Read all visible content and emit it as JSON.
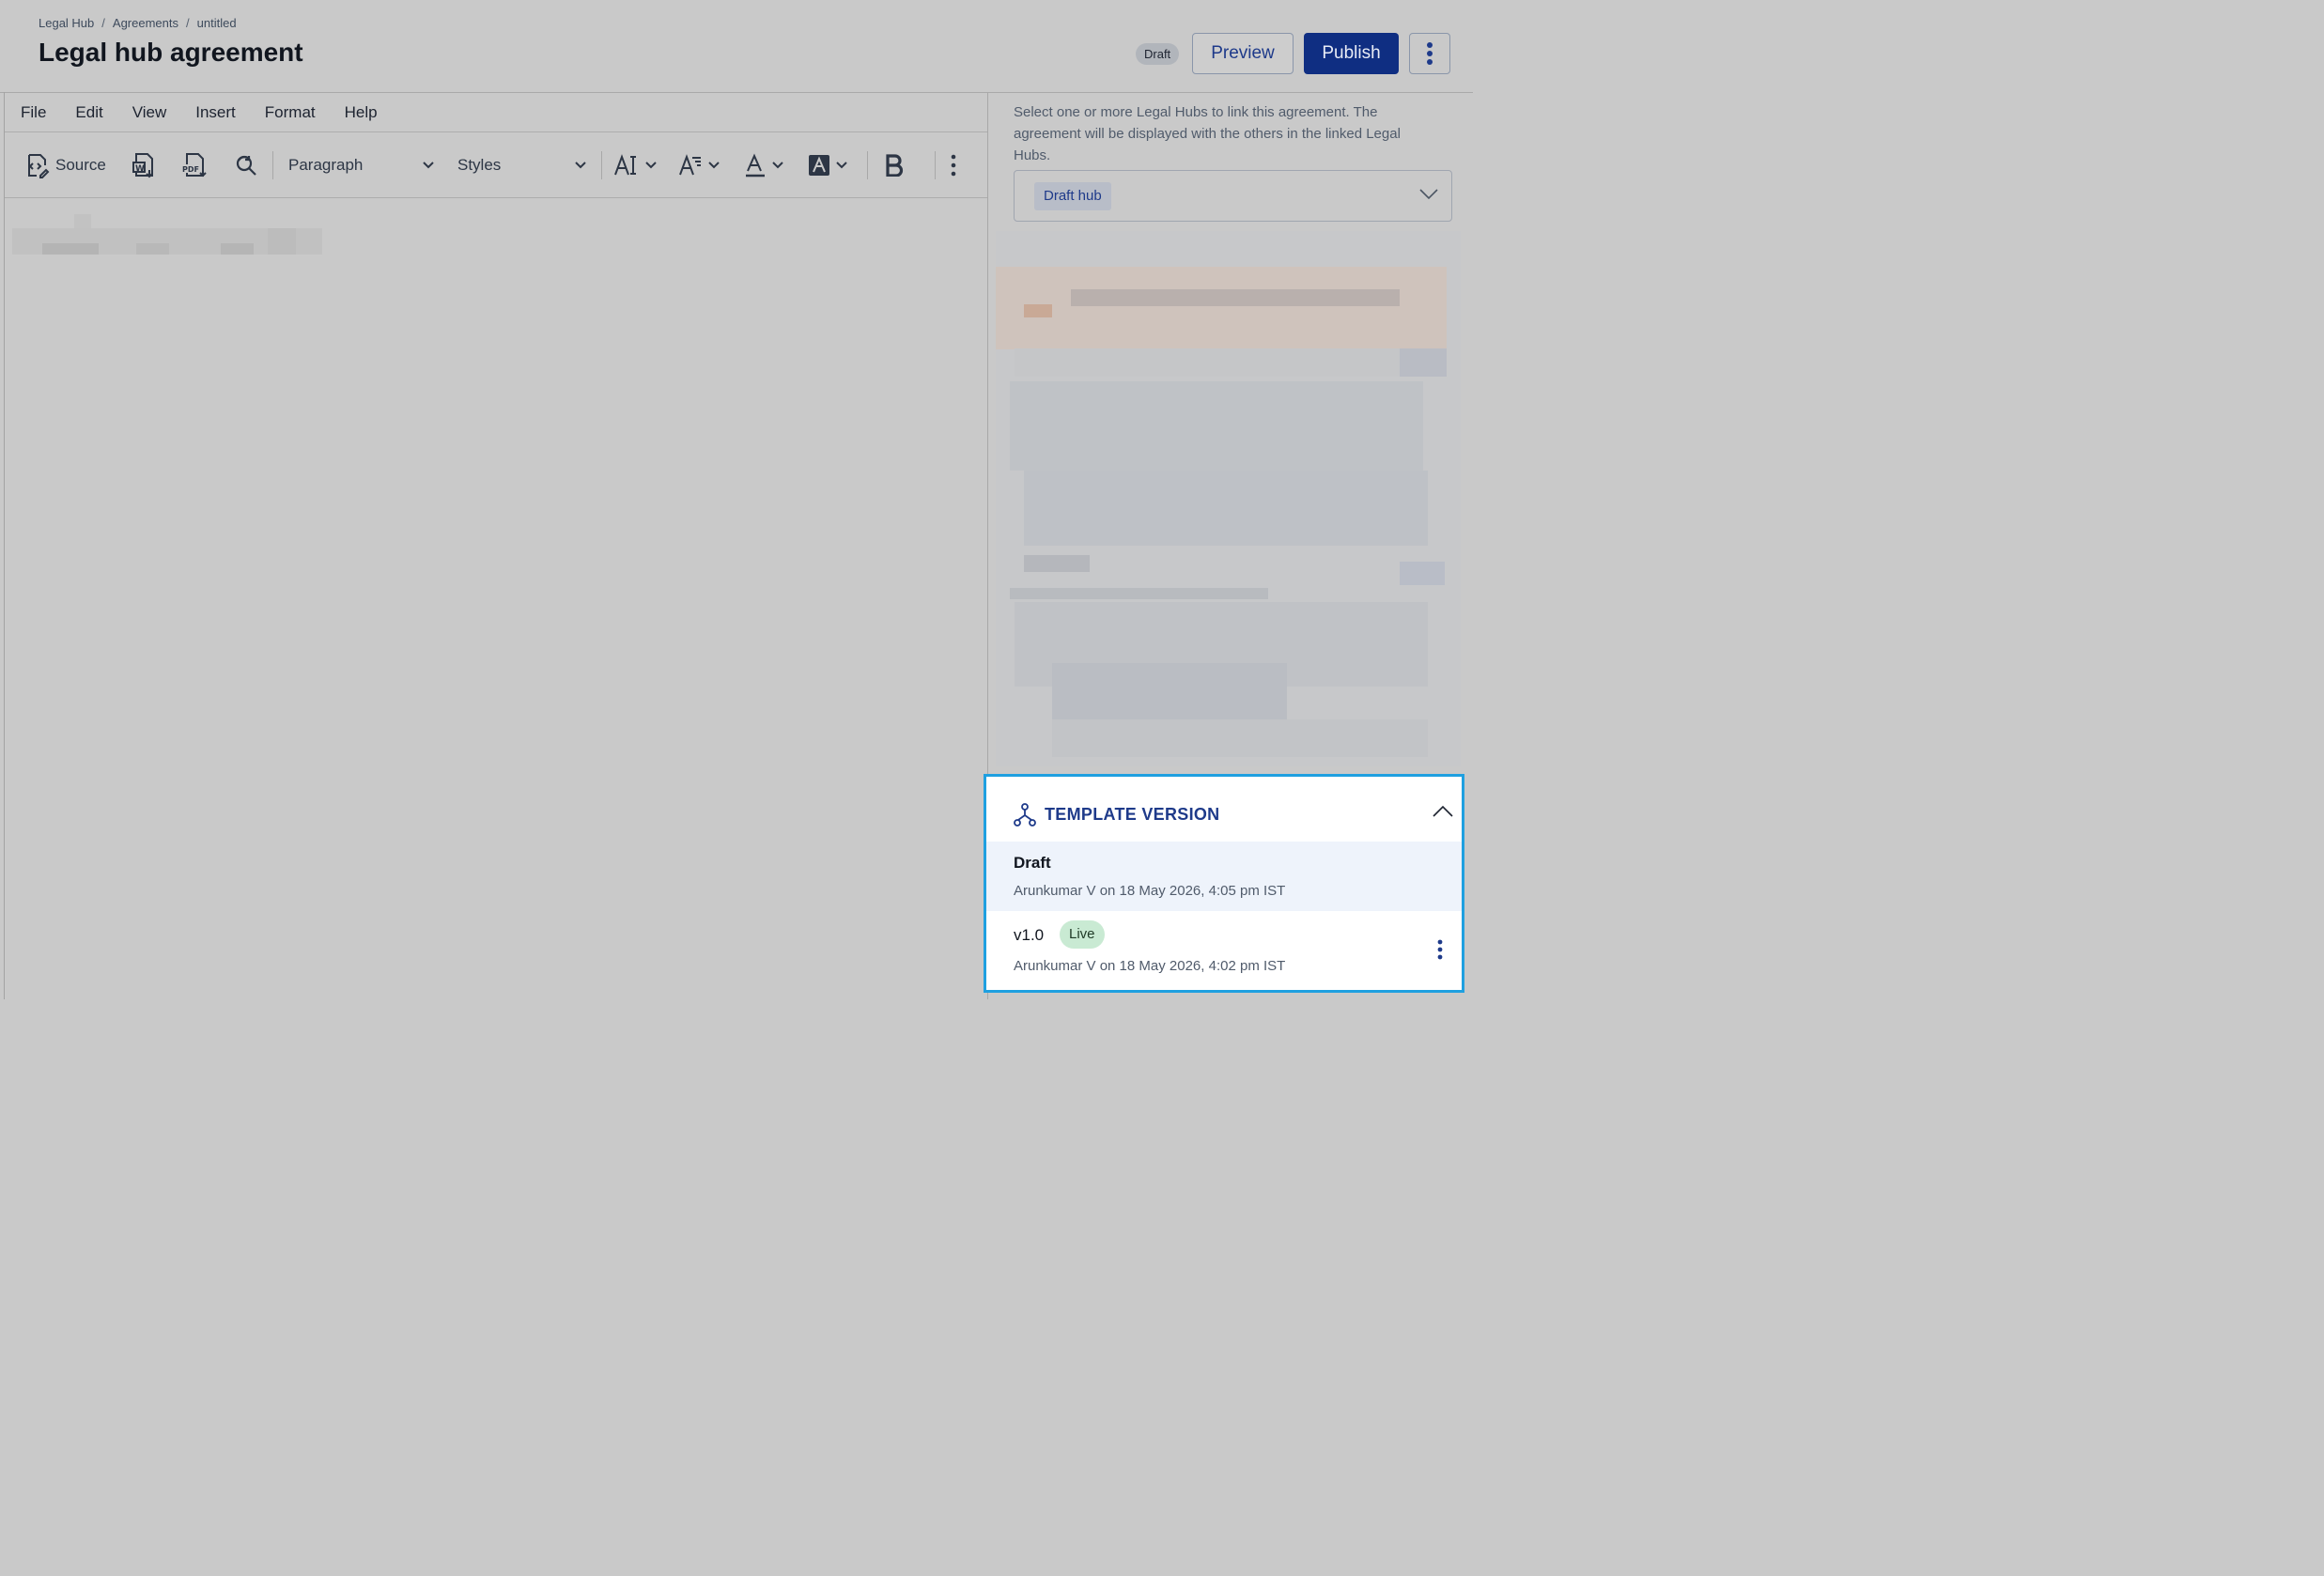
{
  "breadcrumb": {
    "items": [
      "Legal Hub",
      "Agreements",
      "untitled"
    ],
    "sep": "/"
  },
  "header": {
    "title": "Legal hub agreement",
    "status": "Draft",
    "preview_label": "Preview",
    "publish_label": "Publish"
  },
  "menu": {
    "items": [
      "File",
      "Edit",
      "View",
      "Insert",
      "Format",
      "Help"
    ]
  },
  "toolbar": {
    "source_label": "Source",
    "paragraph_label": "Paragraph",
    "styles_label": "Styles"
  },
  "hub": {
    "description": "Select one or more Legal Hubs to link this agreement. The agreement will be displayed with the others in the linked Legal Hubs.",
    "selected_chip": "Draft hub"
  },
  "template_version": {
    "title": "TEMPLATE VERSION",
    "versions": [
      {
        "name": "Draft",
        "meta": "Arunkumar V on 18 May 2026, 4:05 pm IST"
      },
      {
        "name": "v1.0",
        "badge": "Live",
        "meta": "Arunkumar V on 18 May 2026, 4:02 pm IST"
      }
    ]
  },
  "colors": {
    "accent": "#1e3a8a",
    "publish_bg": "#0f2e82",
    "highlight_border": "#1fa0e0",
    "live_badge": "#c9ead3"
  }
}
